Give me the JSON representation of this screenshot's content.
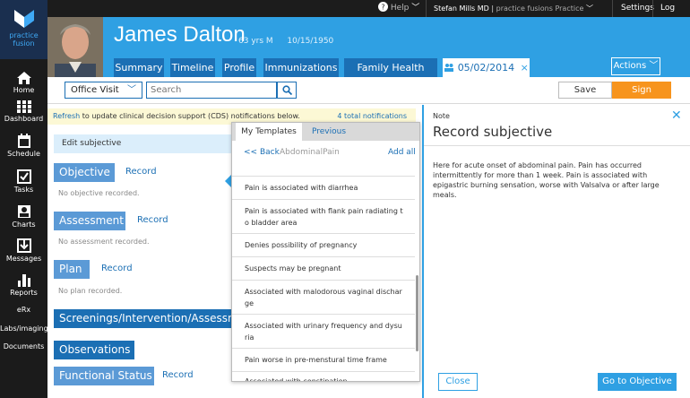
{
  "brand": {
    "line1": "practice",
    "line2": "fusion"
  },
  "nav": [
    {
      "label": "Home",
      "icon": "home-icon"
    },
    {
      "label": "Dashboard",
      "icon": "dashboard-icon"
    },
    {
      "label": "Schedule",
      "icon": "calendar-icon"
    },
    {
      "label": "Tasks",
      "icon": "checkbox-icon"
    },
    {
      "label": "Charts",
      "icon": "chart-person-icon"
    },
    {
      "label": "Messages",
      "icon": "inbox-icon"
    },
    {
      "label": "Reports",
      "icon": "bar-chart-icon"
    },
    {
      "label": "eRx",
      "icon": ""
    },
    {
      "label": "Labs/imaging",
      "icon": ""
    },
    {
      "label": "Documents",
      "icon": ""
    }
  ],
  "topbar": {
    "help": "Help",
    "user": "Stefan Mills MD",
    "practice": "practice fusions Practice",
    "settings": "Settings",
    "logout": "Log out"
  },
  "patient": {
    "name": "James Dalton",
    "age_sex": "63 yrs M",
    "dob": "10/15/1950"
  },
  "tabs": [
    "Summary",
    "Timeline",
    "Profile",
    "Immunizations",
    "Family Health History"
  ],
  "encounter_tab": {
    "date": "05/02/2014"
  },
  "actions_label": "Actions",
  "toolbar": {
    "visit_type": "Office Visit",
    "search_placeholder": "Search",
    "save_label": "Save",
    "sign_label": "Sign"
  },
  "cds": {
    "link": "Refresh",
    "text": "to update clinical decision support (CDS) notifications below.",
    "count": "4 total notifications"
  },
  "sections": {
    "edit_subjective": "Edit subjective",
    "objective": "Objective",
    "objective_none": "No objective recorded.",
    "assessment": "Assessment",
    "assessment_none": "No assessment recorded.",
    "plan": "Plan",
    "plan_none": "No plan recorded.",
    "screenings": "Screenings/Intervention/Assessment",
    "observations": "Observations",
    "functional": "Functional Status",
    "record": "Record"
  },
  "templates": {
    "tab_my": "My Templates",
    "tab_prev": "Previous",
    "back": "<< Back",
    "category": "AbdominalPain",
    "add_all": "Add all",
    "items": [
      "Pain is associated with diarrhea",
      "Pain is associated with flank pain radiating t",
      "o bladder area",
      "Denies possibility of pregnancy",
      "Suspects may be pregnant",
      "Associated with malodorous vaginal dischar",
      "ge",
      "Associated with urinary frequency and dysu",
      "ria",
      "Pain worse in pre-menstural time frame",
      "Associated with constipation"
    ]
  },
  "note": {
    "label": "Note",
    "title": "Record subjective",
    "text": "Here for acute onset of abdominal pain. Pain has occurred intermittently for more than 1 week. Pain is associated with epigastric burning sensation, worse with Valsalva or after large meals.",
    "close_label": "Close",
    "goto_label": "Go to Objective"
  },
  "colors": {
    "brand_blue": "#2fa0e3",
    "dark_blue": "#1b6fb4",
    "sign_orange": "#f7941d",
    "sidebar": "#1b1b1b"
  }
}
